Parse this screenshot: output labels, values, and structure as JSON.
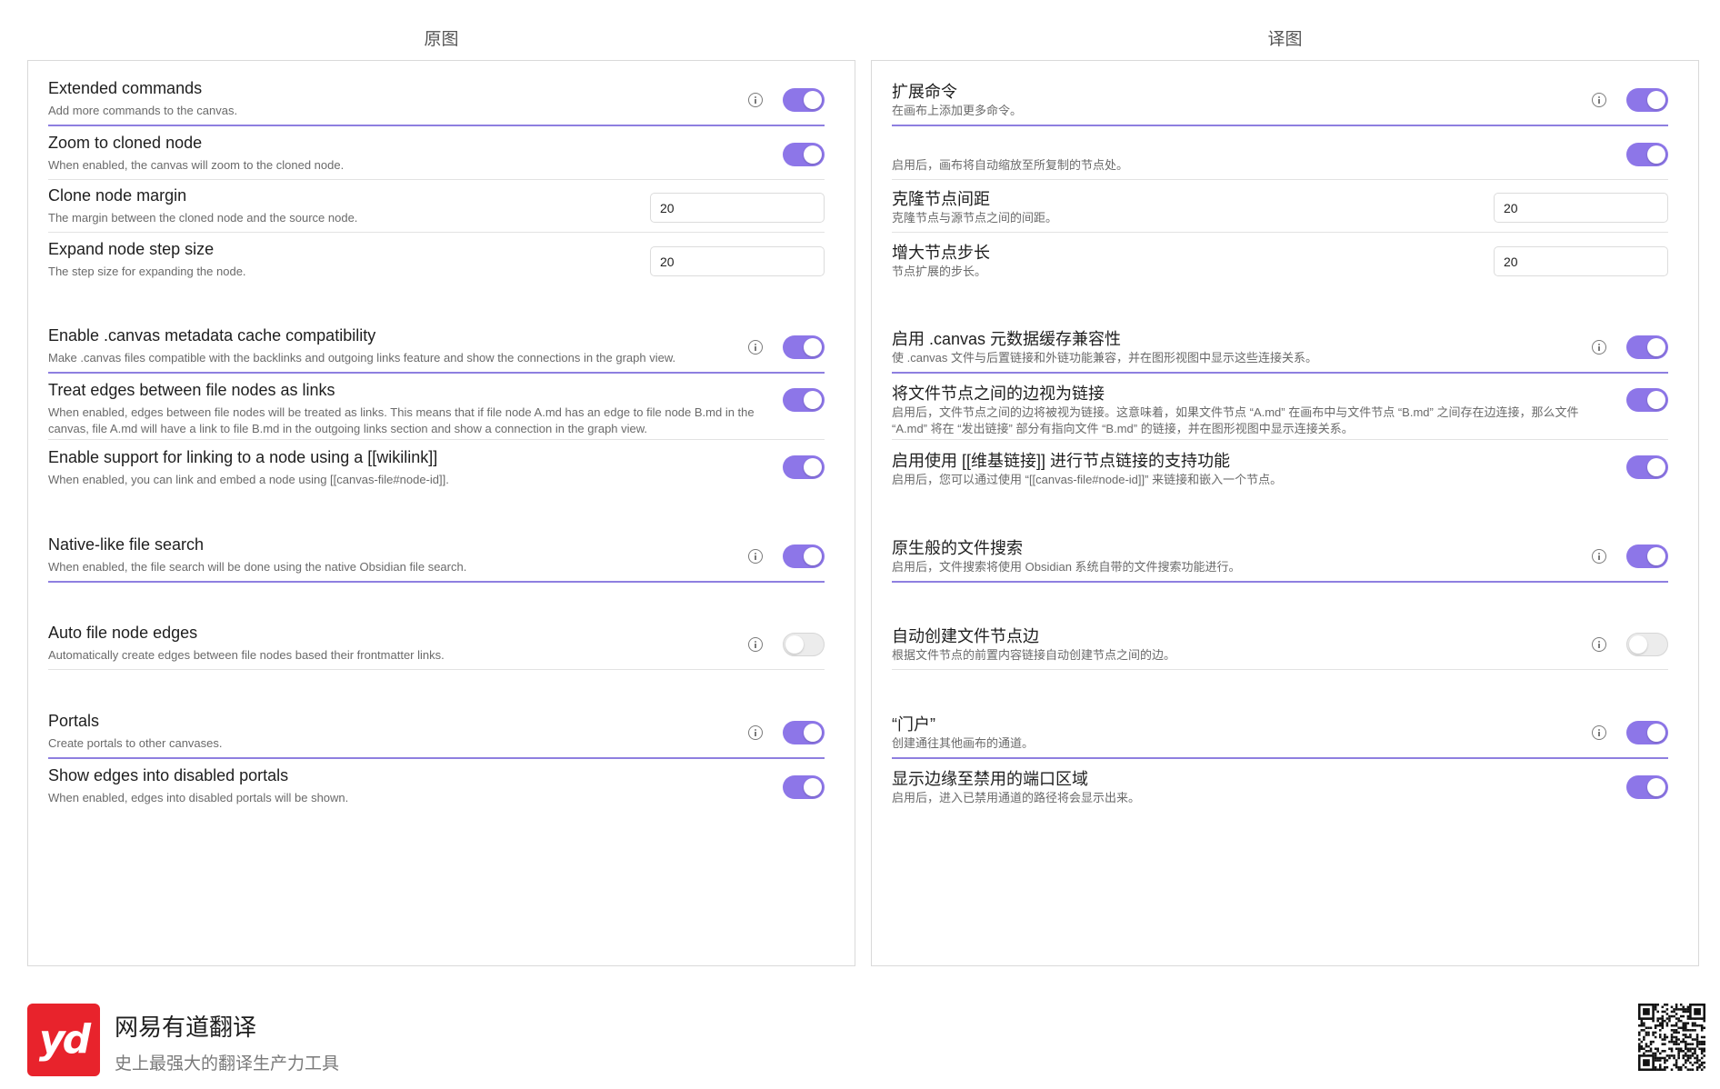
{
  "colors": {
    "accent": "#8d76e8",
    "logo_red": "#e8232c"
  },
  "left": {
    "title": "原图",
    "items": [
      {
        "name": "Extended commands",
        "desc": "Add more commands to the canvas.",
        "info": true,
        "toggle": "on"
      },
      {
        "name": "Zoom to cloned node",
        "desc": "When enabled, the canvas will zoom to the cloned node.",
        "info": false,
        "toggle": "on"
      },
      {
        "name": "Clone node margin",
        "desc": "The margin between the cloned node and the source node.",
        "input": "20"
      },
      {
        "name": "Expand node step size",
        "desc": "The step size for expanding the node.",
        "input": "20"
      },
      {
        "name": "Enable .canvas metadata cache compatibility",
        "desc": "Make .canvas files compatible with the backlinks and outgoing links feature and show the connections in the graph view.",
        "info": true,
        "toggle": "on"
      },
      {
        "name": "Treat edges between file nodes as links",
        "desc": "When enabled, edges between file nodes will be treated as links. This means that if file node A.md has an edge to file node B.md in the canvas, file A.md will have a link to file B.md in the outgoing links section and show a connection in the graph view.",
        "info": false,
        "toggle": "on"
      },
      {
        "name": "Enable support for linking to a node using a [[wikilink]]",
        "desc": "When enabled, you can link and embed a node using [[canvas-file#node-id]].",
        "info": false,
        "toggle": "on"
      },
      {
        "name": "Native-like file search",
        "desc": "When enabled, the file search will be done using the native Obsidian file search.",
        "info": true,
        "toggle": "on"
      },
      {
        "name": "Auto file node edges",
        "desc": "Automatically create edges between file nodes based their frontmatter links.",
        "info": true,
        "toggle": "off"
      },
      {
        "name": "Portals",
        "desc": "Create portals to other canvases.",
        "info": true,
        "toggle": "on"
      },
      {
        "name": "Show edges into disabled portals",
        "desc": "When enabled, edges into disabled portals will be shown.",
        "info": false,
        "toggle": "on"
      }
    ]
  },
  "right": {
    "title": "译图",
    "items": [
      {
        "name": "扩展命令",
        "desc": "在画布上添加更多命令。",
        "info": true,
        "toggle": "on"
      },
      {
        "name": "",
        "desc": "启用后，画布将自动缩放至所复制的节点处。",
        "info": false,
        "toggle": "on"
      },
      {
        "name": "克隆节点间距",
        "desc": "克隆节点与源节点之间的间距。",
        "input": "20"
      },
      {
        "name": "增大节点步长",
        "desc": "节点扩展的步长。",
        "input": "20"
      },
      {
        "name": "启用 .canvas 元数据缓存兼容性",
        "desc": "使 .canvas 文件与后置链接和外链功能兼容，并在图形视图中显示这些连接关系。",
        "info": true,
        "toggle": "on"
      },
      {
        "name": "将文件节点之间的边视为链接",
        "desc": "启用后，文件节点之间的边将被视为链接。这意味着，如果文件节点 “A.md” 在画布中与文件节点 “B.md” 之间存在边连接，那么文件 “A.md” 将在 “发出链接” 部分有指向文件 “B.md” 的链接，并在图形视图中显示连接关系。",
        "info": false,
        "toggle": "on"
      },
      {
        "name": "启用使用 [[维基链接]] 进行节点链接的支持功能",
        "desc": "启用后，您可以通过使用 “[[canvas-file#node-id]]” 来链接和嵌入一个节点。",
        "info": false,
        "toggle": "on"
      },
      {
        "name": "原生般的文件搜索",
        "desc": "启用后，文件搜索将使用 Obsidian 系统自带的文件搜索功能进行。",
        "info": true,
        "toggle": "on"
      },
      {
        "name": "自动创建文件节点边",
        "desc": "根据文件节点的前置内容链接自动创建节点之间的边。",
        "info": true,
        "toggle": "off"
      },
      {
        "name": "“门户”",
        "desc": "创建通往其他画布的通道。",
        "info": true,
        "toggle": "on"
      },
      {
        "name": "显示边缘至禁用的端口区域",
        "desc": "启用后，进入已禁用通道的路径将会显示出来。",
        "info": false,
        "toggle": "on"
      }
    ]
  },
  "footer": {
    "logo_text": "yd",
    "brand_name": "网易有道翻译",
    "slogan": "史上最强大的翻译生产力工具",
    "qr_icon": "qr-code-icon"
  }
}
